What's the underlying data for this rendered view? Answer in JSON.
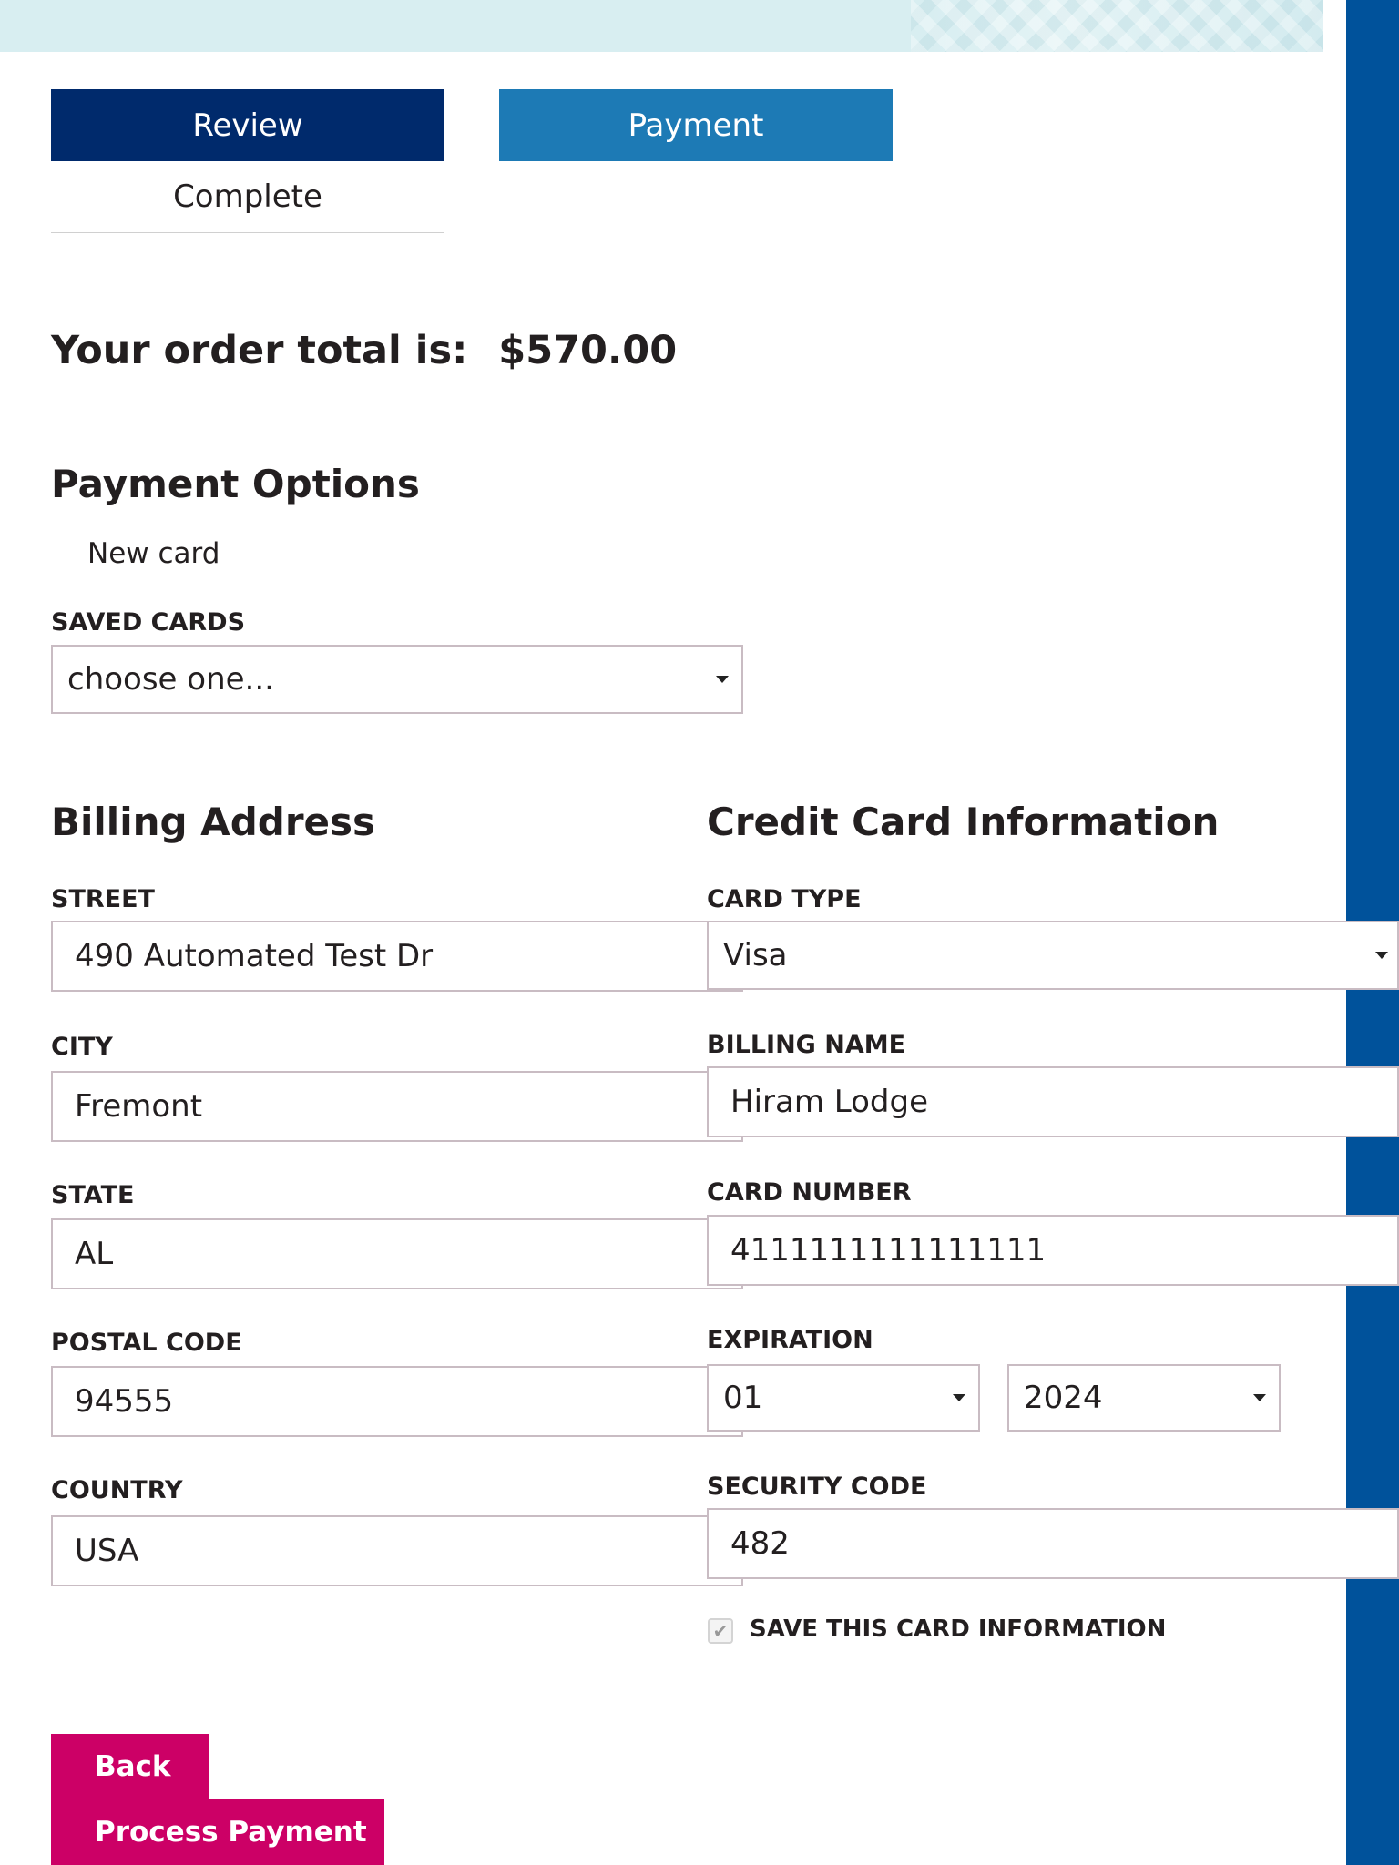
{
  "steps": {
    "review": "Review",
    "payment": "Payment",
    "complete": "Complete"
  },
  "order": {
    "total_label": "Your order total is:",
    "total_value": "$570.00"
  },
  "payment_options": {
    "title": "Payment Options",
    "new_card": "New card",
    "saved_cards_label": "SAVED CARDS",
    "saved_cards_value": "choose one..."
  },
  "billing": {
    "title": "Billing Address",
    "street_label": "STREET",
    "street_value": "490 Automated Test Dr",
    "city_label": "CITY",
    "city_value": "Fremont",
    "state_label": "STATE",
    "state_value": "AL",
    "postal_label": "POSTAL CODE",
    "postal_value": "94555",
    "country_label": "COUNTRY",
    "country_value": "USA"
  },
  "card": {
    "title": "Credit Card Information",
    "type_label": "CARD TYPE",
    "type_value": "Visa",
    "name_label": "BILLING NAME",
    "name_value": "Hiram Lodge",
    "number_label": "CARD NUMBER",
    "number_value": "4111111111111111",
    "expiration_label": "EXPIRATION",
    "exp_month": "01",
    "exp_year": "2024",
    "security_label": "SECURITY CODE",
    "security_value": "482",
    "save_label": "SAVE THIS CARD INFORMATION",
    "save_checked": true
  },
  "buttons": {
    "back": "Back",
    "process": "Process Payment"
  },
  "colors": {
    "step_active": "#002a6c",
    "step_current": "#1d7ab5",
    "button": "#cc0066",
    "side_bar": "#00529b"
  }
}
